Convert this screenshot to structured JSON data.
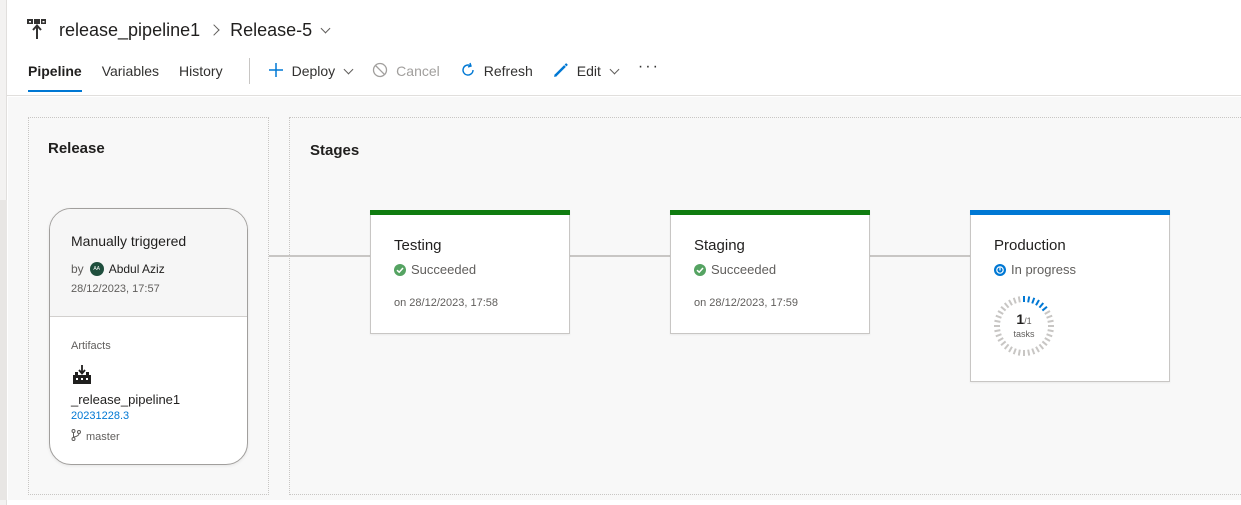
{
  "header": {
    "pipeline_name": "release_pipeline1",
    "release_name": "Release-5",
    "pipeline_icon": "release-pipeline-icon"
  },
  "tabs": [
    {
      "label": "Pipeline",
      "active": true
    },
    {
      "label": "Variables",
      "active": false
    },
    {
      "label": "History",
      "active": false
    }
  ],
  "toolbar": {
    "deploy_label": "Deploy",
    "cancel_label": "Cancel",
    "refresh_label": "Refresh",
    "edit_label": "Edit",
    "more_label": "···"
  },
  "release_panel": {
    "title": "Release",
    "trigger": "Manually triggered",
    "by_label": "by",
    "user_initials": "AA",
    "user_name": "Abdul Aziz",
    "date": "28/12/2023, 17:57",
    "artifacts_label": "Artifacts",
    "artifact_name": "_release_pipeline1",
    "build": "20231228.3",
    "branch": "master"
  },
  "stages_panel": {
    "title": "Stages",
    "stages": [
      {
        "name": "Testing",
        "status": "Succeeded",
        "status_icon": "check-circle-icon",
        "date": "on 28/12/2023, 17:58",
        "color": "#107c10"
      },
      {
        "name": "Staging",
        "status": "Succeeded",
        "status_icon": "check-circle-icon",
        "date": "on 28/12/2023, 17:59",
        "color": "#107c10"
      },
      {
        "name": "Production",
        "status": "In progress",
        "status_icon": "in-progress-icon",
        "color": "#0078d4",
        "tasks": {
          "done": "1",
          "total": "/1",
          "label": "tasks"
        }
      }
    ]
  },
  "colors": {
    "accent": "#0078d4",
    "success": "#107c10",
    "success_icon": "#55a362"
  }
}
